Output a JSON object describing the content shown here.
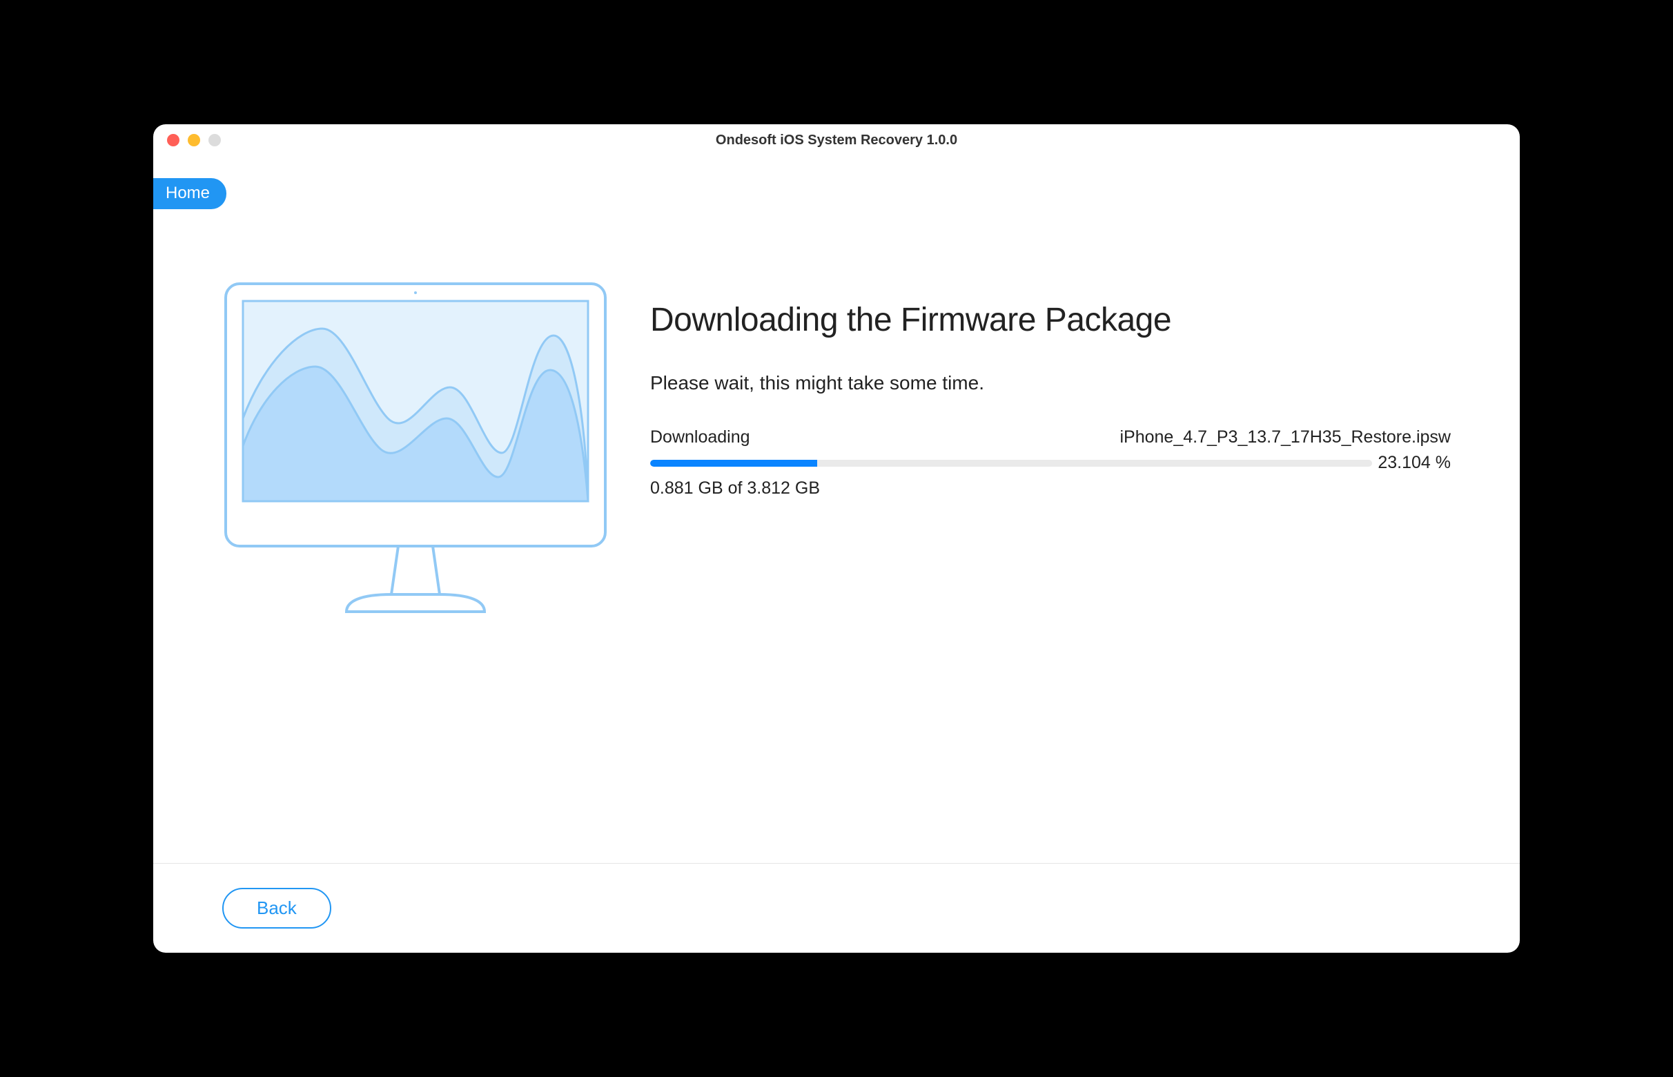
{
  "window": {
    "title": "Ondesoft iOS System Recovery 1.0.0"
  },
  "breadcrumb": {
    "label": "Home"
  },
  "main": {
    "heading": "Downloading the Firmware Package",
    "subtext": "Please wait, this might take some time.",
    "status_label": "Downloading",
    "filename": "iPhone_4.7_P3_13.7_17H35_Restore.ipsw",
    "progress_percent": 23.104,
    "progress_percent_display": "23.104 %",
    "size_text": "0.881 GB of 3.812 GB"
  },
  "footer": {
    "back_label": "Back"
  },
  "colors": {
    "accent": "#2196f3",
    "progress": "#0a84ff"
  }
}
